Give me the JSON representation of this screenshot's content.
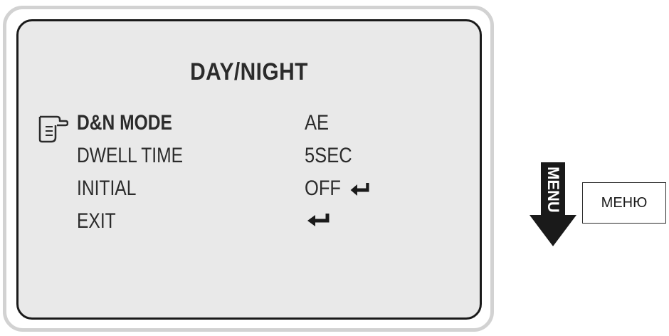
{
  "osd": {
    "title": "DAY/NIGHT",
    "items": [
      {
        "label": "D&N MODE",
        "value": "AE",
        "selected": true,
        "enter": false
      },
      {
        "label": "DWELL TIME",
        "value": "5SEC",
        "selected": false,
        "enter": false
      },
      {
        "label": "INITIAL",
        "value": "OFF",
        "selected": false,
        "enter": true
      },
      {
        "label": "EXIT",
        "value": "",
        "selected": false,
        "enter": true
      }
    ],
    "cursor_icon": "pointing-hand-icon",
    "enter_icon": "enter-return-icon"
  },
  "menu_button": {
    "arrow_text": "MENU",
    "icon": "down-arrow-icon"
  },
  "callout": {
    "label": "МЕНЮ"
  },
  "colors": {
    "screen_bg": "#e9e9e9",
    "text": "#2b2b2b",
    "frame": "#d2d2d2"
  }
}
